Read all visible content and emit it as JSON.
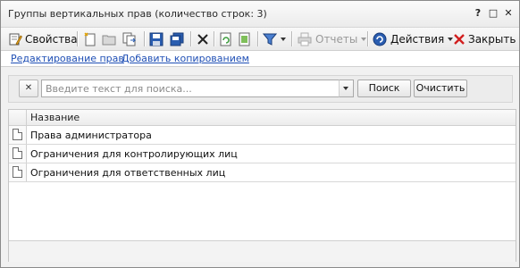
{
  "window": {
    "title": "Группы вертикальных прав (количество строк: 3)",
    "help_glyph": "?",
    "maximize_glyph": "□",
    "close_glyph": "✕"
  },
  "toolbar": {
    "properties_label": "Свойства",
    "reports_label": "Отчеты",
    "actions_label": "Действия",
    "close_label": "Закрыть"
  },
  "links": {
    "edit_rights": "Редактирование прав",
    "add_copy": "Добавить копированием"
  },
  "search": {
    "clear_glyph": "✕",
    "placeholder": "Введите текст для поиска...",
    "value": "",
    "search_button": "Поиск",
    "clear_button": "Очистить"
  },
  "grid": {
    "column_name": "Название",
    "rows": [
      {
        "name": "Права администратора"
      },
      {
        "name": "Ограничения для контролирующих лиц"
      },
      {
        "name": "Ограничения для ответственных лиц"
      }
    ]
  },
  "colors": {
    "link": "#1f4fb5",
    "accent_blue": "#2a5db0",
    "close_red": "#d21f1f"
  }
}
